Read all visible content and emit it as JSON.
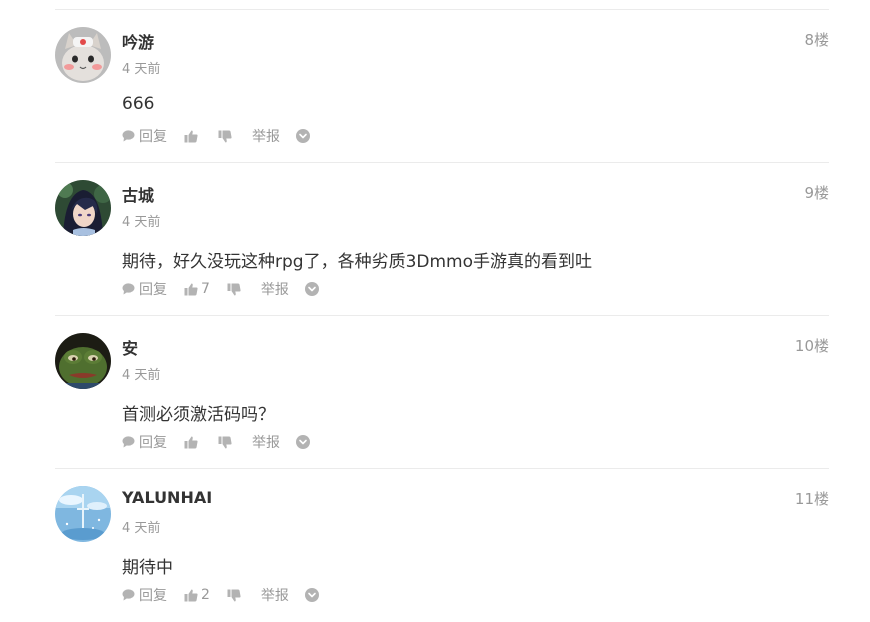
{
  "comments": [
    {
      "username": "吟游",
      "time": "4 天前",
      "floor": "8楼",
      "content": "666",
      "reply_label": "回复",
      "like_count": "",
      "report_label": "举报",
      "avatar_icon": "cat-avatar-icon"
    },
    {
      "username": "古城",
      "time": "4 天前",
      "floor": "9楼",
      "content": "期待，好久没玩这种rpg了，各种劣质3Dmmo手游真的看到吐",
      "reply_label": "回复",
      "like_count": "7",
      "report_label": "举报",
      "avatar_icon": "anime-character-avatar-icon"
    },
    {
      "username": "安",
      "time": "4 天前",
      "floor": "10楼",
      "content": "首测必须激活码吗？",
      "reply_label": "回复",
      "like_count": "",
      "report_label": "举报",
      "avatar_icon": "frog-avatar-icon"
    },
    {
      "username": "YALUNHAI",
      "time": "4 天前",
      "floor": "11楼",
      "content": "期待中",
      "reply_label": "回复",
      "like_count": "2",
      "report_label": "举报",
      "avatar_icon": "sky-scene-avatar-icon"
    }
  ],
  "colors": {
    "text": "#333333",
    "muted": "#999999",
    "icon": "#b3b3b3",
    "divider": "#ebebeb"
  }
}
